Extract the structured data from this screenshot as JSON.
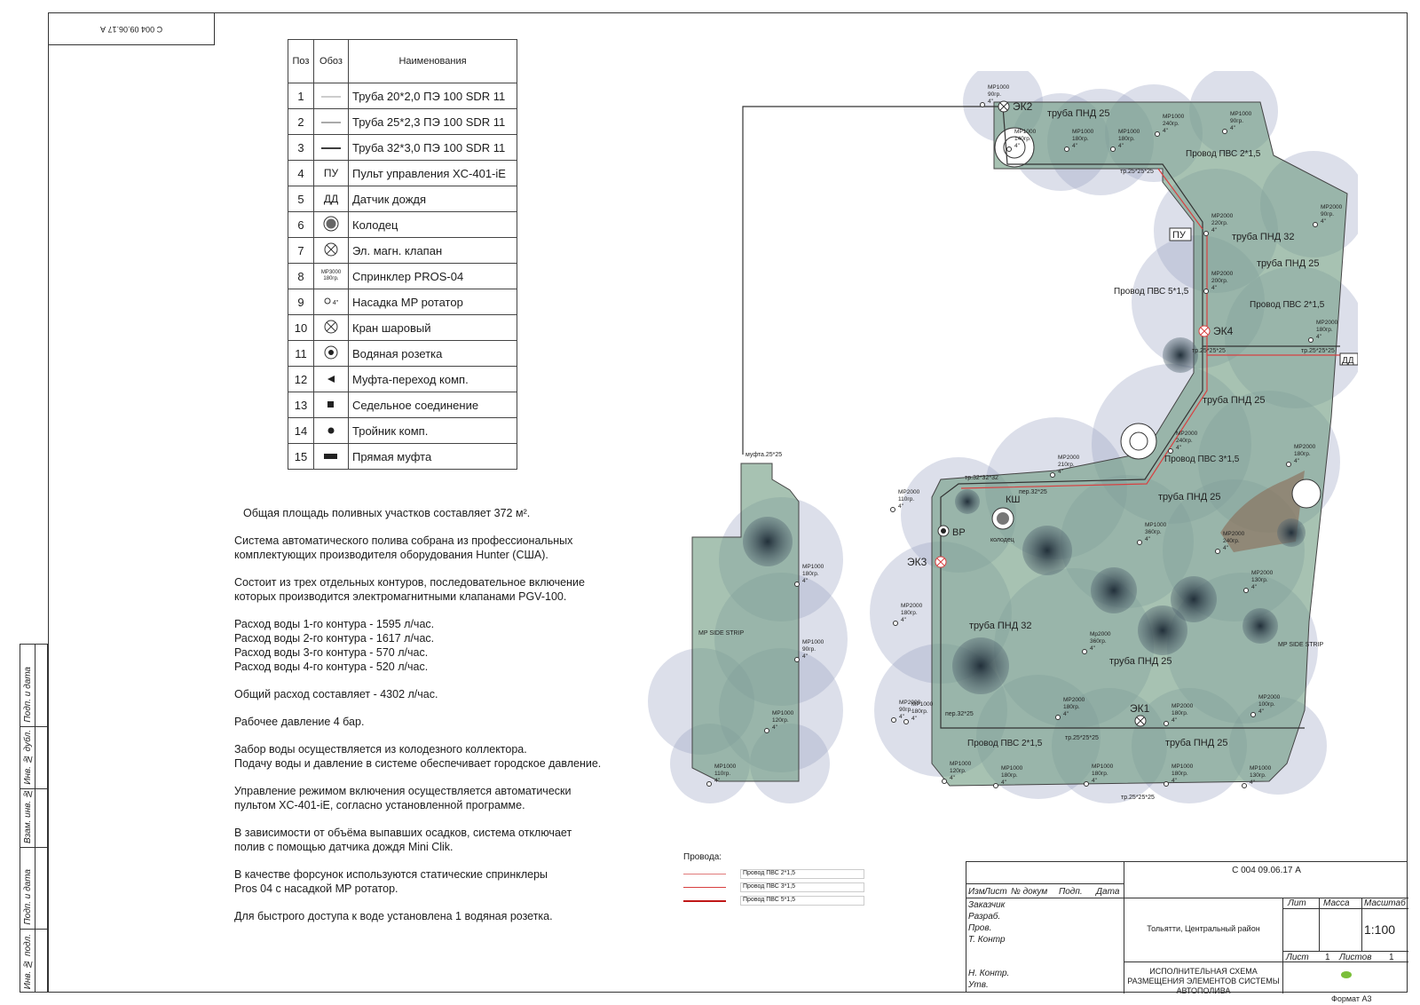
{
  "sheet_code": "С 004 09.06.17 А",
  "legend": {
    "headers": [
      "Поз",
      "Обоз",
      "Наименования"
    ],
    "rows": [
      {
        "pos": "1",
        "sym": "",
        "name": "Труба 20*2,0 ПЭ 100 SDR 11"
      },
      {
        "pos": "2",
        "sym": "",
        "name": "Труба 25*2,3 ПЭ 100 SDR 11"
      },
      {
        "pos": "3",
        "sym": "",
        "name": "Труба 32*3,0 ПЭ 100 SDR 11"
      },
      {
        "pos": "4",
        "sym": "ПУ",
        "name": "Пульт управления XC-401-iE"
      },
      {
        "pos": "5",
        "sym": "ДД",
        "name": "Датчик дождя"
      },
      {
        "pos": "6",
        "sym": "",
        "name": "Колодец"
      },
      {
        "pos": "7",
        "sym": "",
        "name": "Эл. магн. клапан"
      },
      {
        "pos": "8",
        "sym": "MP3000 180гр.",
        "name": "Спринклер PROS-04"
      },
      {
        "pos": "9",
        "sym": "4\"",
        "name": "Насадка MP ротатор"
      },
      {
        "pos": "10",
        "sym": "",
        "name": "Кран шаровый"
      },
      {
        "pos": "11",
        "sym": "",
        "name": "Водяная розетка"
      },
      {
        "pos": "12",
        "sym": "",
        "name": "Муфта-переход комп."
      },
      {
        "pos": "13",
        "sym": "",
        "name": "Седельное соединение"
      },
      {
        "pos": "14",
        "sym": "",
        "name": "Тройник комп."
      },
      {
        "pos": "15",
        "sym": "",
        "name": "Прямая муфта"
      }
    ]
  },
  "notes": [
    "Общая площадь поливных участков составляет 372 м².",
    "Система автоматического полива собрана из профессиональных\nкомплектующих производителя оборудования Hunter (США).",
    "Состоит из трех отдельных контуров, последовательное включение\nкоторых производится электромагнитными клапанами PGV-100.",
    "Расход воды 1-го контура - 1595 л/час.\nРасход воды 2-го контура - 1617 л/час.\nРасход воды 3-го контура - 570 л/час.\nРасход воды 4-го контура - 520 л/час.",
    "Общий расход составляет - 4302 л/час.",
    "Рабочее давление 4 бар.",
    "Забор воды осуществляется из колодезного коллектора.\nПодачу воды и давление в системе обеспечивает городское давление.",
    "Управление режимом включения осуществляется автоматически\nпультом XC-401-iE, согласно установленной программе.",
    "В зависимости от объёма выпавших осадков, система отключает\nполив с помощью датчика дождя Mini Clik.",
    "В качестве форсунок используются статические спринклеры\nPros 04 с насадкой MP ротатор.",
    "Для быстрого доступа к воде установлена 1 водяная розетка."
  ],
  "wires": {
    "title": "Провода:",
    "items": [
      {
        "label": "Провод ПВС 2*1,5",
        "color": "#e07a7a"
      },
      {
        "label": "Провод ПВС 3*1,5",
        "color": "#d84040"
      },
      {
        "label": "Провод ПВС 5*1,5",
        "color": "#c01818"
      }
    ]
  },
  "side_strip": [
    "Инв. № подл.",
    "Подп. и дата",
    "Взам. инв. №",
    "Инв. № дубл.",
    "Подп. и дата"
  ],
  "titleblock": {
    "code": "С 004 09.06.17 А",
    "cols": [
      "Изм",
      "Лист",
      "№ докум",
      "Подп.",
      "Дата"
    ],
    "roles": [
      "Заказчик",
      "Разраб.",
      "Пров.",
      "Т. Контр",
      "Н. Контр.",
      "Утв."
    ],
    "location": "Тольятти, Центральный район",
    "title": "ИСПОЛНИТЕЛЬНАЯ СХЕМА РАЗМЕЩЕНИЯ ЭЛЕМЕНТОВ СИСТЕМЫ АВТОПОЛИВА",
    "lit": "Лит",
    "mass": "Масса",
    "scale_label": "Масштаб",
    "scale": "1:100",
    "sheet_label": "Лист",
    "sheet_num": "1",
    "sheets_label": "Листов",
    "sheets_num": "1",
    "format": "Формат А3"
  },
  "plan_labels": {
    "ek1": "ЭК1",
    "ek2": "ЭК2",
    "ek3": "ЭК3",
    "ek4": "ЭК4",
    "pu": "ПУ",
    "dd": "ДД",
    "ksh": "КШ",
    "vr": "ВР",
    "well": "колодец",
    "pipe_pnd25": "труба ПНД 25",
    "pipe_pnd32": "труба ПНД 32",
    "wire_2": "Провод ПВС 2*1,5",
    "wire_3": "Провод ПВС 3*1,5",
    "wire_5": "Провод ПВС 5*1,5",
    "mufta": "муфта.25*25",
    "tee_32": "тр.32*32*32",
    "per_32_25": "пер.32*25",
    "tee_25": "тр.25*25*25",
    "strip": "MP SIDE STRIP"
  },
  "sprinklers": [
    {
      "model": "MP1000",
      "angle": "90гр.",
      "size": "4\""
    },
    {
      "model": "MP1000",
      "angle": "140гр.",
      "size": "4\""
    },
    {
      "model": "MP1000",
      "angle": "180гр.",
      "size": "4\""
    },
    {
      "model": "MP1000",
      "angle": "240гр.",
      "size": "4\""
    },
    {
      "model": "MP1000",
      "angle": "180гр.",
      "size": "4\""
    },
    {
      "model": "MP1000",
      "angle": "90гр.",
      "size": "4\""
    },
    {
      "model": "MP2000",
      "angle": "220гр.",
      "size": "4\""
    },
    {
      "model": "MP2000",
      "angle": "200гр.",
      "size": "4\""
    },
    {
      "model": "MP2000",
      "angle": "90гр.",
      "size": "4\""
    },
    {
      "model": "MP2000",
      "angle": "180гр.",
      "size": "4\""
    },
    {
      "model": "MP2000",
      "angle": "240гр.",
      "size": "4\""
    },
    {
      "model": "MP2000",
      "angle": "210гр.",
      "size": "4\""
    },
    {
      "model": "MP2000",
      "angle": "110гр.",
      "size": "4\""
    },
    {
      "model": "MP1000",
      "angle": "360гр.",
      "size": "4\""
    },
    {
      "model": "MP2000",
      "angle": "240гр.",
      "size": "4\""
    },
    {
      "model": "MP2000",
      "angle": "180гр.",
      "size": "4\""
    },
    {
      "model": "MP2000",
      "angle": "130гр.",
      "size": "4\""
    },
    {
      "model": "MP2000",
      "angle": "180гр.",
      "size": "4\""
    },
    {
      "model": "Mp2000",
      "angle": "360гр.",
      "size": "4\""
    },
    {
      "model": "MP2000",
      "angle": "90гр.",
      "size": "4\""
    },
    {
      "model": "MP2000",
      "angle": "180гр.",
      "size": "4\""
    },
    {
      "model": "MP2000",
      "angle": "180гр.",
      "size": "4\""
    },
    {
      "model": "MP2000",
      "angle": "100гр.",
      "size": "4\""
    },
    {
      "model": "MP1000",
      "angle": "120гр.",
      "size": "4\""
    },
    {
      "model": "MP1000",
      "angle": "180гр.",
      "size": "4\""
    },
    {
      "model": "MP1000",
      "angle": "180гр.",
      "size": "4\""
    },
    {
      "model": "MP1000",
      "angle": "180гр.",
      "size": "4\""
    },
    {
      "model": "MP1000",
      "angle": "130гр.",
      "size": "4\""
    },
    {
      "model": "MP1000",
      "angle": "180гр.",
      "size": "4\""
    },
    {
      "model": "MP1000",
      "angle": "180гр.",
      "size": "4\""
    },
    {
      "model": "MP1000",
      "angle": "90гр.",
      "size": "4\""
    },
    {
      "model": "MP1000",
      "angle": "120гр.",
      "size": "4\""
    },
    {
      "model": "MP1000",
      "angle": "110гр.",
      "size": "4\""
    }
  ]
}
